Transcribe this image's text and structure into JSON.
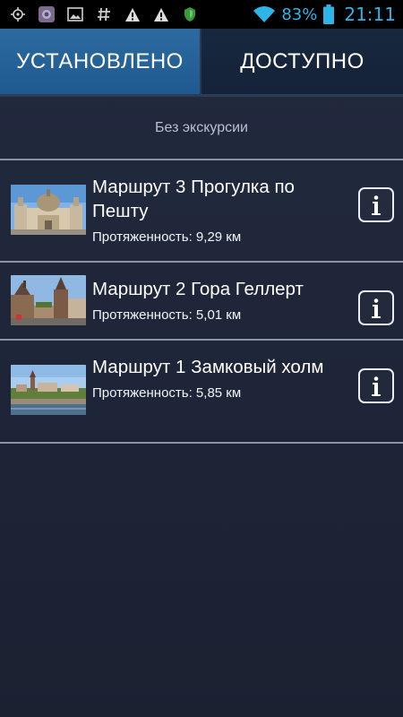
{
  "status_bar": {
    "battery_percent": "83%",
    "time": "21:11",
    "left_icons": [
      "gps-icon",
      "app-icon",
      "image-icon",
      "hash-icon",
      "warning-icon",
      "warning-icon",
      "shield-icon"
    ],
    "accent_color": "#2fb4e8"
  },
  "tabs": [
    {
      "label": "УСТАНОВЛЕНО",
      "selected": true
    },
    {
      "label": "ДОСТУПНО",
      "selected": false
    }
  ],
  "no_tour_label": "Без экскурсии",
  "routes": [
    {
      "title": "Маршрут 3 Прогулка по Пешту",
      "length": "Протяженность: 9,29 км",
      "thumbnail": "basilica-photo"
    },
    {
      "title": "Маршрут 2 Гора Геллерт",
      "length": "Протяженность: 5,01 км",
      "thumbnail": "gellert-photo"
    },
    {
      "title": "Маршрут 1 Замковый холм",
      "length": "Протяженность: 5,85 км",
      "thumbnail": "castle-hill-photo"
    }
  ],
  "info_icon_label": "i"
}
